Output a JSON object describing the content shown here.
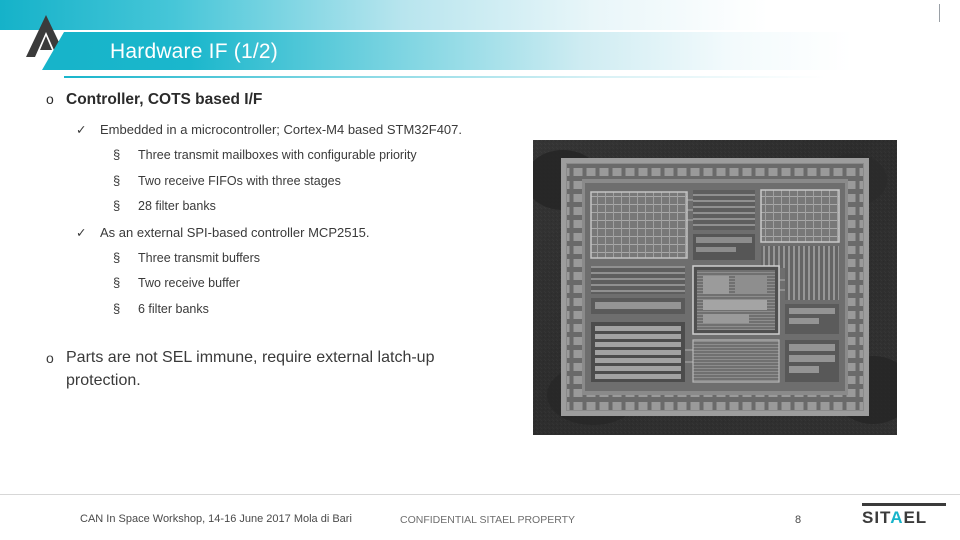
{
  "slide": {
    "title": "Hardware IF (1/2)",
    "logo_icon": "sitael-triangle-logo"
  },
  "content": {
    "bullet_1": {
      "marker": "o",
      "text": "Controller, COTS based  I/F",
      "sub": [
        {
          "marker": "✓",
          "text": "Embedded  in  a  microcontroller;  Cortex-M4  based STM32F407.",
          "sub": [
            {
              "marker": "§",
              "text": "Three transmit mailboxes with configurable priority"
            },
            {
              "marker": "§",
              "text": "Two receive FIFOs with three stages"
            },
            {
              "marker": "§",
              "text": " 28 filter banks"
            }
          ]
        },
        {
          "marker": "✓",
          "text": "As an external SPI-based controller MCP2515.",
          "sub": [
            {
              "marker": "§",
              "text": "Three transmit buffers"
            },
            {
              "marker": "§",
              "text": "Two receive buffer"
            },
            {
              "marker": "§",
              "text": "6 filter banks"
            }
          ]
        }
      ]
    },
    "bullet_2": {
      "marker": "o",
      "text": "Parts are not SEL immune, require external latch-up protection."
    }
  },
  "image": {
    "name": "die-photo-microcontroller",
    "alt": "Greyscale microscope photograph of an integrated circuit die"
  },
  "footer": {
    "left": "CAN In Space Workshop, 14-16 June 2017 Mola di Bari",
    "center": "CONFIDENTIAL SITAEL PROPERTY",
    "page": "8",
    "logo_text_pre": "SIT",
    "logo_text_accent": "A",
    "logo_text_post": "EL"
  },
  "colors": {
    "accent": "#17b4ca",
    "text": "#3a3a3a",
    "title_text": "#ffffff"
  }
}
